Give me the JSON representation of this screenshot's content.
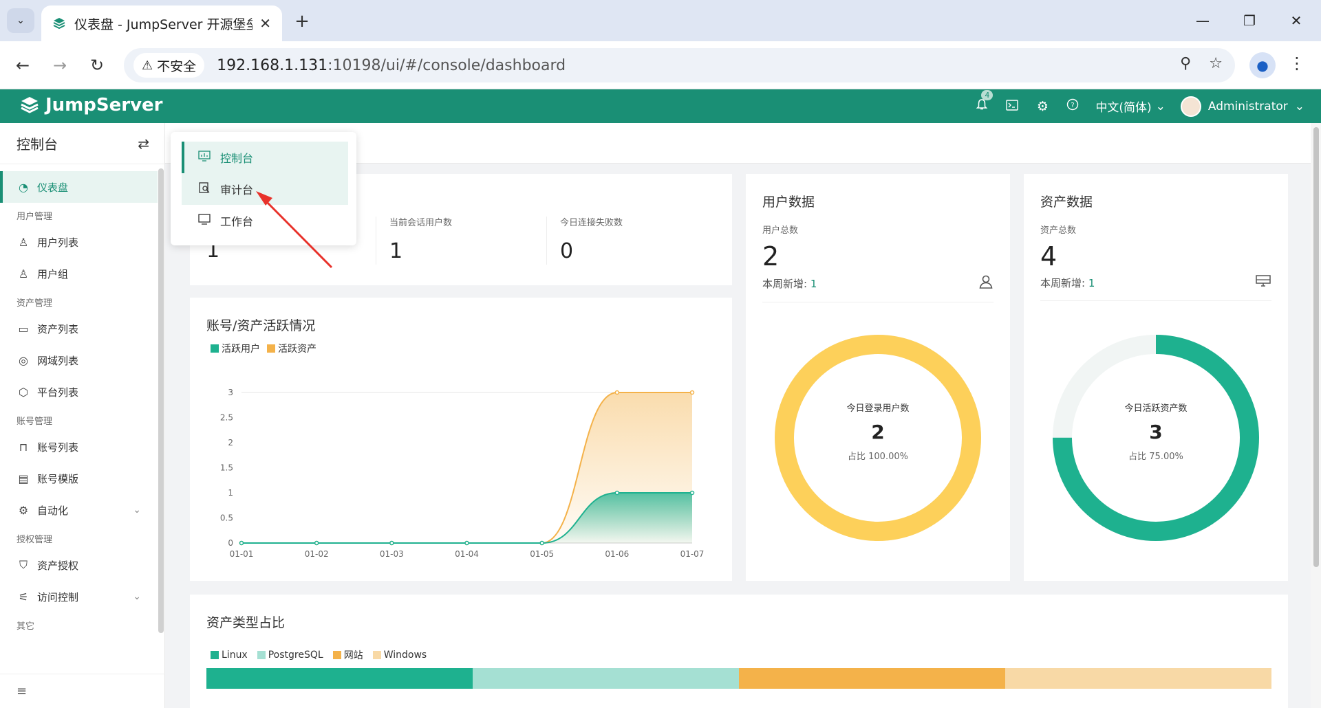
{
  "browser": {
    "tab_title": "仪表盘 - JumpServer 开源堡垒",
    "security_label": "不安全",
    "url_host": "192.168.1.131",
    "url_rest": ":10198/ui/#/console/dashboard"
  },
  "header": {
    "brand": "JumpServer",
    "notification_count": "4",
    "language": "中文(简体)",
    "user_name": "Administrator"
  },
  "sidebar": {
    "title": "控制台",
    "items": [
      {
        "type": "item",
        "label": "仪表盘",
        "icon": "dashboard-icon",
        "active": true
      },
      {
        "type": "group",
        "label": "用户管理"
      },
      {
        "type": "item",
        "label": "用户列表",
        "icon": "user-icon"
      },
      {
        "type": "item",
        "label": "用户组",
        "icon": "users-icon"
      },
      {
        "type": "group",
        "label": "资产管理"
      },
      {
        "type": "item",
        "label": "资产列表",
        "icon": "monitor-icon"
      },
      {
        "type": "item",
        "label": "网域列表",
        "icon": "location-icon"
      },
      {
        "type": "item",
        "label": "平台列表",
        "icon": "cube-icon"
      },
      {
        "type": "group",
        "label": "账号管理"
      },
      {
        "type": "item",
        "label": "账号列表",
        "icon": "lock-icon"
      },
      {
        "type": "item",
        "label": "账号模版",
        "icon": "template-icon"
      },
      {
        "type": "item",
        "label": "自动化",
        "icon": "automation-icon",
        "expandable": true
      },
      {
        "type": "group",
        "label": "授权管理"
      },
      {
        "type": "item",
        "label": "资产授权",
        "icon": "shield-icon"
      },
      {
        "type": "item",
        "label": "访问控制",
        "icon": "filter-icon",
        "expandable": true
      },
      {
        "type": "group",
        "label": "其它"
      }
    ]
  },
  "dropdown": {
    "items": [
      {
        "label": "控制台",
        "icon": "console-icon",
        "state": "active"
      },
      {
        "label": "审计台",
        "icon": "audit-icon",
        "state": "hover"
      },
      {
        "label": "工作台",
        "icon": "workbench-icon",
        "state": ""
      }
    ]
  },
  "stats": {
    "first_value": "1",
    "session_users_label": "当前会话用户数",
    "session_users_value": "1",
    "failed_label": "今日连接失败数",
    "failed_value": "0"
  },
  "activity_chart": {
    "title": "账号/资产活跃情况",
    "legend_users": "活跃用户",
    "legend_assets": "活跃资产"
  },
  "user_data": {
    "title": "用户数据",
    "total_label": "用户总数",
    "total_value": "2",
    "weekly_label": "本周新增:",
    "weekly_value": "1",
    "donut_label": "今日登录用户数",
    "donut_value": "2",
    "donut_ratio": "占比 100.00%",
    "donut_fraction": 1.0,
    "color": "#fdd05a"
  },
  "asset_data": {
    "title": "资产数据",
    "total_label": "资产总数",
    "total_value": "4",
    "weekly_label": "本周新增:",
    "weekly_value": "1",
    "donut_label": "今日活跃资产数",
    "donut_value": "3",
    "donut_ratio": "占比 75.00%",
    "donut_fraction": 0.75,
    "color": "#1eb18f"
  },
  "asset_types": {
    "title": "资产类型占比",
    "items": [
      {
        "label": "Linux",
        "share": 0.25,
        "color": "#1eb18f"
      },
      {
        "label": "PostgreSQL",
        "share": 0.25,
        "color": "#a5e0d3"
      },
      {
        "label": "网站",
        "share": 0.25,
        "color": "#f4b24a"
      },
      {
        "label": "Windows",
        "share": 0.25,
        "color": "#f8d9a6"
      }
    ]
  },
  "chart_data": {
    "type": "area",
    "title": "账号/资产活跃情况",
    "x": [
      "01-01",
      "01-02",
      "01-03",
      "01-04",
      "01-05",
      "01-06",
      "01-07"
    ],
    "series": [
      {
        "name": "活跃用户",
        "values": [
          0,
          0,
          0,
          0,
          0,
          1,
          1
        ],
        "color": "#1eb18f"
      },
      {
        "name": "活跃资产",
        "values": [
          0,
          0,
          0,
          0,
          0,
          3,
          3
        ],
        "color": "#f4b24a"
      }
    ],
    "yticks": [
      "0",
      "0.5",
      "1",
      "1.5",
      "2",
      "2.5",
      "3"
    ],
    "ylim": [
      0,
      3
    ],
    "legend_position": "top-left",
    "grid": "horizontal-line-at-top"
  }
}
